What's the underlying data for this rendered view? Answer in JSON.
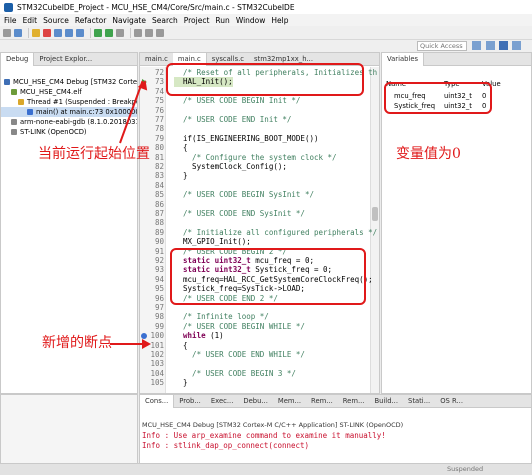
{
  "window": {
    "title": "STM32CubeIDE_Project - MCU_HSE_CM4/Core/Src/main.c - STM32CubeIDE"
  },
  "menu": [
    "File",
    "Edit",
    "Source",
    "Refactor",
    "Navigate",
    "Search",
    "Project",
    "Run",
    "Window",
    "Help"
  ],
  "quick_access": {
    "placeholder": "Quick Access"
  },
  "debug_panel": {
    "tabs": [
      "Debug",
      "Project Explor..."
    ],
    "tree": [
      "MCU_HSE_CM4 Debug [STM32 Cortex",
      "MCU_HSE_CM4.elf",
      "Thread #1 (Suspended : Breakpo",
      "main() at main.c:73 0x1000009",
      "arm-none-eabi-gdb (8.1.0.20180315",
      "ST-LINK (OpenOCD)"
    ]
  },
  "editor": {
    "tabs": [
      "main.c",
      "main.c",
      "syscalls.c",
      "stm32mp1xx_h..."
    ],
    "lines": [
      {
        "n": "72",
        "t": "  /* Reset of all peripherals, Initializes th",
        "c": "cm"
      },
      {
        "n": "73",
        "t": "  HAL_Init();",
        "c": "hl"
      },
      {
        "n": "74",
        "t": "",
        "c": ""
      },
      {
        "n": "75",
        "t": "  /* USER CODE BEGIN Init */",
        "c": "cm"
      },
      {
        "n": "76",
        "t": "",
        "c": ""
      },
      {
        "n": "77",
        "t": "  /* USER CODE END Init */",
        "c": "cm"
      },
      {
        "n": "78",
        "t": "",
        "c": ""
      },
      {
        "n": "79",
        "t": "  if(IS_ENGINEERING_BOOT_MODE())",
        "c": ""
      },
      {
        "n": "80",
        "t": "  {",
        "c": ""
      },
      {
        "n": "81",
        "t": "    /* Configure the system clock */",
        "c": "cm"
      },
      {
        "n": "82",
        "t": "    SystemClock_Config();",
        "c": ""
      },
      {
        "n": "83",
        "t": "  }",
        "c": ""
      },
      {
        "n": "84",
        "t": "",
        "c": ""
      },
      {
        "n": "85",
        "t": "  /* USER CODE BEGIN SysInit */",
        "c": "cm"
      },
      {
        "n": "86",
        "t": "",
        "c": ""
      },
      {
        "n": "87",
        "t": "  /* USER CODE END SysInit */",
        "c": "cm"
      },
      {
        "n": "88",
        "t": "",
        "c": ""
      },
      {
        "n": "89",
        "t": "  /* Initialize all configured peripherals */",
        "c": "cm"
      },
      {
        "n": "90",
        "t": "  MX_GPIO_Init();",
        "c": ""
      },
      {
        "n": "91",
        "t": "  /* USER CODE BEGIN 2 */",
        "c": "cm"
      },
      {
        "n": "92",
        "t": "  static uint32_t mcu_freq = 0;",
        "c": "kw"
      },
      {
        "n": "93",
        "t": "  static uint32_t Systick_freq = 0;",
        "c": "kw"
      },
      {
        "n": "94",
        "t": "  mcu_freq=HAL_RCC_GetSystemCoreClockFreq();",
        "c": ""
      },
      {
        "n": "95",
        "t": "  Systick_freq=SysTick->LOAD;",
        "c": ""
      },
      {
        "n": "96",
        "t": "  /* USER CODE END 2 */",
        "c": "cm"
      },
      {
        "n": "97",
        "t": "",
        "c": ""
      },
      {
        "n": "98",
        "t": "  /* Infinite loop */",
        "c": "cm"
      },
      {
        "n": "99",
        "t": "  /* USER CODE BEGIN WHILE */",
        "c": "cm"
      },
      {
        "n": "100",
        "t": "  while (1)",
        "c": "kw"
      },
      {
        "n": "101",
        "t": "  {",
        "c": ""
      },
      {
        "n": "102",
        "t": "    /* USER CODE END WHILE */",
        "c": "cm"
      },
      {
        "n": "103",
        "t": "",
        "c": ""
      },
      {
        "n": "104",
        "t": "    /* USER CODE BEGIN 3 */",
        "c": "cm"
      },
      {
        "n": "105",
        "t": "  }",
        "c": ""
      }
    ]
  },
  "variables": {
    "tab": "Variables",
    "headers": [
      "Name",
      "Type",
      "Value"
    ],
    "rows": [
      {
        "name": "mcu_freq",
        "type": "uint32_t",
        "value": "0"
      },
      {
        "name": "Systick_freq",
        "type": "uint32_t",
        "value": "0"
      }
    ]
  },
  "console": {
    "tabs": [
      "Cons...",
      "Prob...",
      "Exec...",
      "Debu...",
      "Mem...",
      "Rem...",
      "Rem...",
      "Build...",
      "Stati...",
      "OS R..."
    ],
    "header": "MCU_HSE_CM4 Debug [STM32 Cortex-M C/C++ Application] ST-LINK (OpenOCD)",
    "lines": [
      "Info : Use arp_examine command to examine it manually!",
      "Info : stlink_dap_op_connect(connect)"
    ]
  },
  "status": {
    "right": "Suspended"
  },
  "annotations": {
    "start_position": "当前运行起始位置",
    "new_breakpoint": "新增的断点",
    "value_zero": "变量值为0",
    "color": "#e0191a"
  }
}
